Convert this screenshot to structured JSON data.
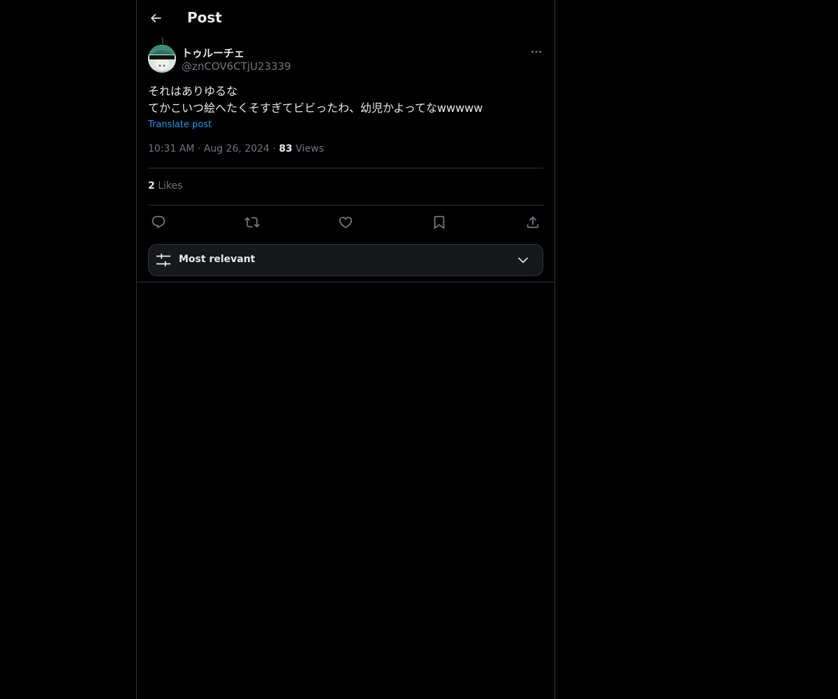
{
  "header": {
    "title": "Post"
  },
  "post": {
    "author_name": "トゥルーチェ",
    "author_handle": "@znCOV6CTjU23339",
    "lines": [
      "それはありゆるな",
      "てかこいつ絵へたくそすぎてビビったわ、幼児かよってなwwwww"
    ],
    "translate_label": "Translate post",
    "time": "10:31 AM",
    "date": "Aug 26, 2024",
    "views_count": "83",
    "views_label": "Views",
    "likes_count": "2",
    "likes_label": "Likes"
  },
  "sort": {
    "label": "Most relevant"
  },
  "colors": {
    "background": "#000000",
    "accent": "#1d9bf0",
    "text": "#e7e9ea",
    "muted": "#71767b",
    "border": "#2f3336"
  }
}
